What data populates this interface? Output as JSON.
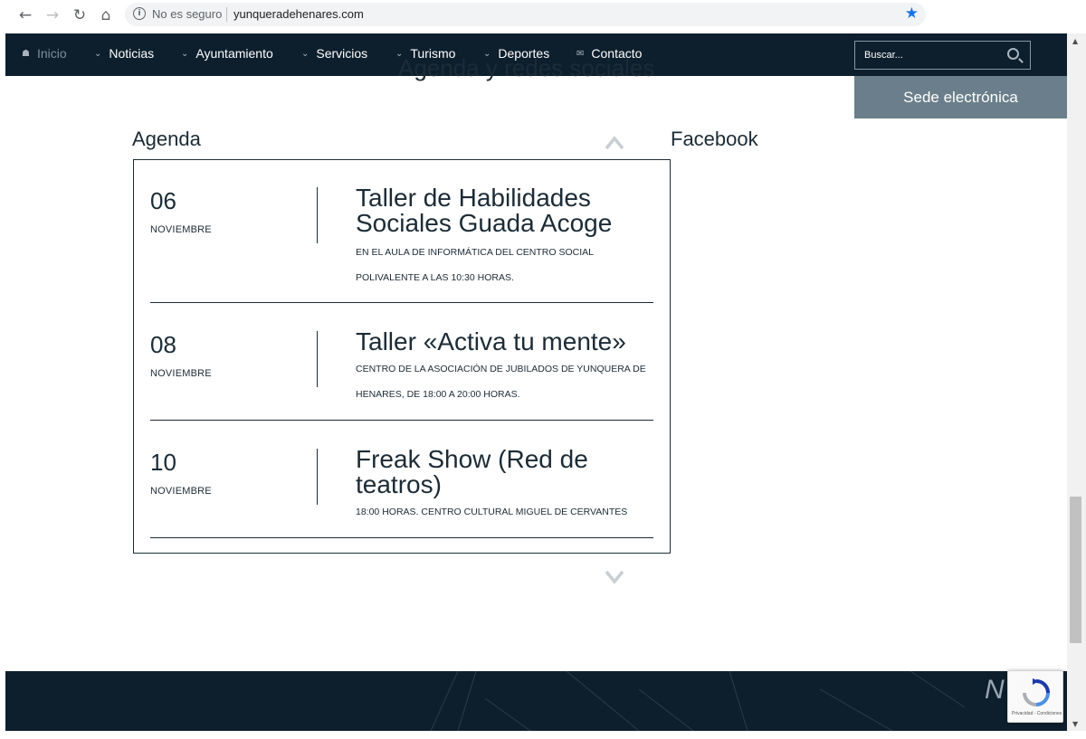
{
  "browser": {
    "security_label": "No es seguro",
    "url": "yunqueradehenares.com"
  },
  "nav": {
    "items": [
      {
        "label": "Inicio",
        "icon": "home-icon"
      },
      {
        "label": "Noticias",
        "icon": "chevron-down-icon"
      },
      {
        "label": "Ayuntamiento",
        "icon": "chevron-down-icon"
      },
      {
        "label": "Servicios",
        "icon": "chevron-down-icon"
      },
      {
        "label": "Turismo",
        "icon": "chevron-down-icon"
      },
      {
        "label": "Deportes",
        "icon": "chevron-down-icon"
      },
      {
        "label": "Contacto",
        "icon": "envelope-icon"
      }
    ],
    "search_placeholder": "Buscar...",
    "sede_label": "Sede electrónica"
  },
  "section": {
    "clipped_title": "Agenda y redes sociales",
    "agenda_heading": "Agenda",
    "facebook_heading": "Facebook"
  },
  "events": [
    {
      "day": "06",
      "month": "NOVIEMBRE",
      "title": "Taller de Habilidades Sociales Guada Acoge",
      "desc": "EN EL AULA DE INFORMÁTICA DEL CENTRO SOCIAL POLIVALENTE A LAS 10:30 HORAS."
    },
    {
      "day": "08",
      "month": "NOVIEMBRE",
      "title": "Taller «Activa tu mente»",
      "desc": "CENTRO DE LA ASOCIACIÓN DE JUBILADOS DE YUNQUERA DE HENARES, DE 18:00 A 20:00 HORAS."
    },
    {
      "day": "10",
      "month": "NOVIEMBRE",
      "title": "Freak Show (Red de teatros)",
      "desc": "18:00 HORAS. CENTRO CULTURAL MIGUEL DE CERVANTES"
    }
  ],
  "footer": {
    "partial_text": "N"
  },
  "recaptcha": {
    "links": "Privacidad - Condiciones"
  },
  "colors": {
    "navy": "#0d1f2d",
    "sede": "#6a7f8b",
    "text": "#1c2b36"
  }
}
